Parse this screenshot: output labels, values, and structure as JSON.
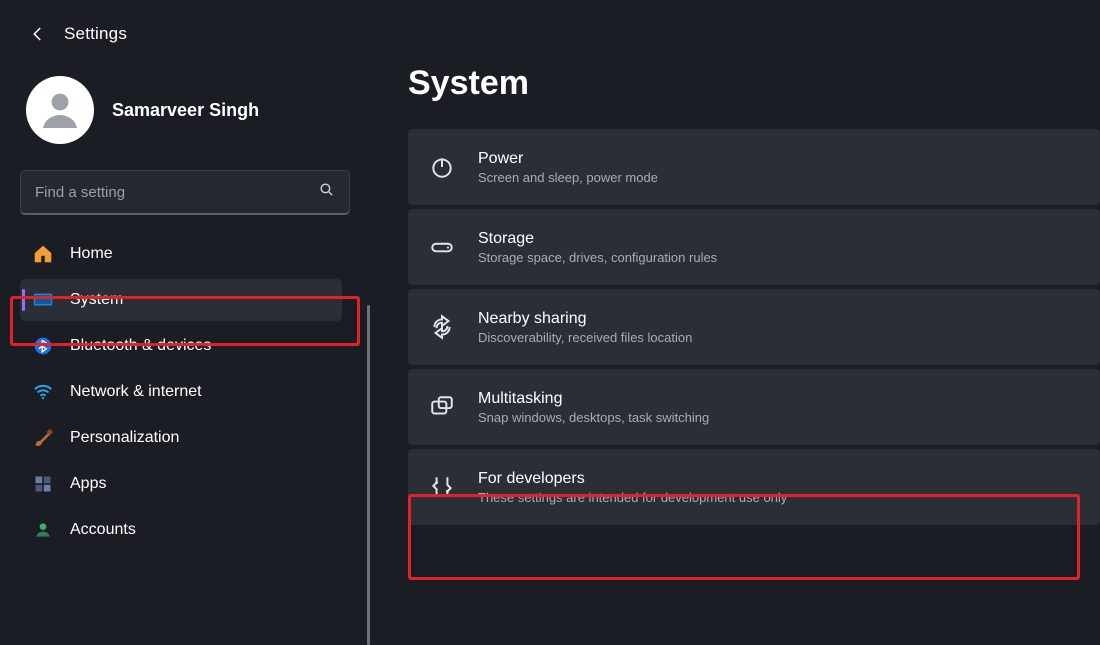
{
  "header": {
    "title": "Settings"
  },
  "profile": {
    "name": "Samarveer Singh"
  },
  "search": {
    "placeholder": "Find a setting"
  },
  "sidebar": {
    "items": [
      {
        "label": "Home"
      },
      {
        "label": "System"
      },
      {
        "label": "Bluetooth & devices"
      },
      {
        "label": "Network & internet"
      },
      {
        "label": "Personalization"
      },
      {
        "label": "Apps"
      },
      {
        "label": "Accounts"
      }
    ]
  },
  "main": {
    "title": "System",
    "cards": [
      {
        "title": "Power",
        "subtitle": "Screen and sleep, power mode"
      },
      {
        "title": "Storage",
        "subtitle": "Storage space, drives, configuration rules"
      },
      {
        "title": "Nearby sharing",
        "subtitle": "Discoverability, received files location"
      },
      {
        "title": "Multitasking",
        "subtitle": "Snap windows, desktops, task switching"
      },
      {
        "title": "For developers",
        "subtitle": "These settings are intended for development use only"
      }
    ]
  }
}
